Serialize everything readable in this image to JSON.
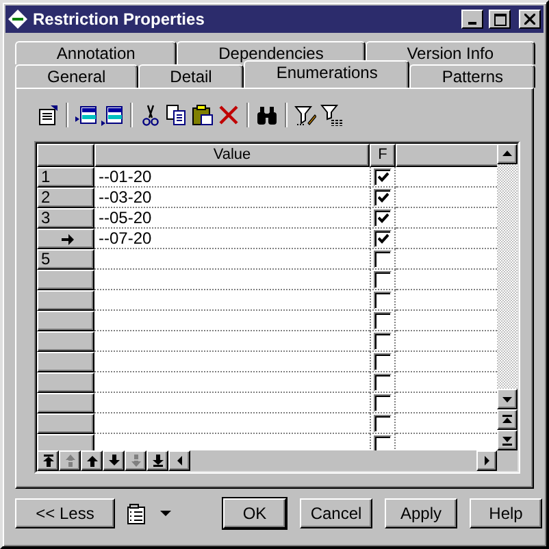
{
  "window": {
    "title": "Restriction Properties"
  },
  "tab_rows": [
    [
      {
        "label": "Annotation",
        "selected": false
      },
      {
        "label": "Dependencies",
        "selected": false
      },
      {
        "label": "Version Info",
        "selected": false
      }
    ],
    [
      {
        "label": "General",
        "selected": false
      },
      {
        "label": "Detail",
        "selected": false
      },
      {
        "label": "Enumerations",
        "selected": true
      },
      {
        "label": "Patterns",
        "selected": false
      }
    ]
  ],
  "grid": {
    "columns": [
      "Value",
      "F"
    ],
    "rows": [
      {
        "header": "1",
        "value": "--01-20",
        "checked": true,
        "current": false
      },
      {
        "header": "2",
        "value": "--03-20",
        "checked": true,
        "current": false
      },
      {
        "header": "3",
        "value": "--05-20",
        "checked": true,
        "current": false
      },
      {
        "value": "--07-20",
        "checked": true,
        "current": true
      },
      {
        "header": "5",
        "checked": false,
        "current": false
      },
      {
        "checked": false,
        "current": false
      },
      {
        "checked": false,
        "current": false
      },
      {
        "checked": false,
        "current": false
      },
      {
        "checked": false,
        "current": false
      },
      {
        "checked": false,
        "current": false
      },
      {
        "checked": false,
        "current": false
      },
      {
        "checked": false,
        "current": false
      },
      {
        "checked": false,
        "current": false
      },
      {
        "checked": false,
        "current": false
      }
    ]
  },
  "less_button": "<< Less",
  "buttons": [
    {
      "label": "OK",
      "default": true
    },
    {
      "label": "Cancel",
      "default": false
    },
    {
      "label": "Apply",
      "default": false
    },
    {
      "label": "Help",
      "default": false
    }
  ]
}
